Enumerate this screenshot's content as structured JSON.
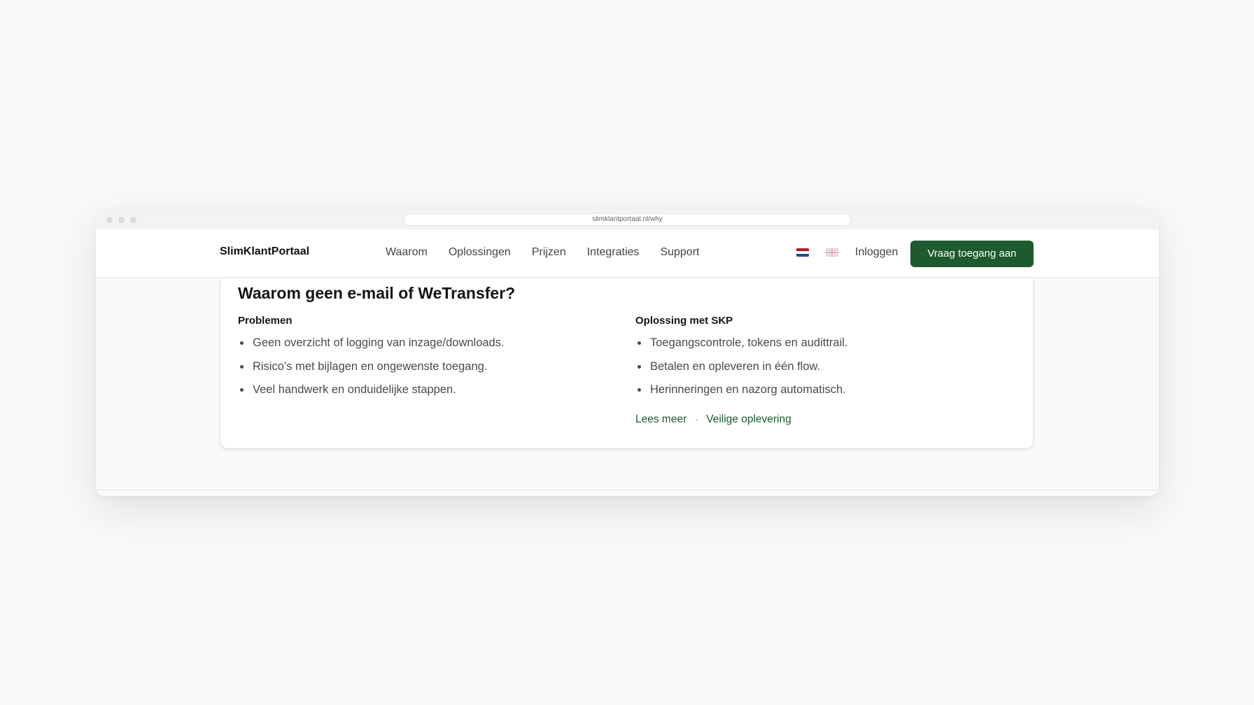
{
  "browser": {
    "url": "slimklantportaal.nl/why"
  },
  "navbar": {
    "brand": "SlimKlantPortaal",
    "links": [
      "Waarom",
      "Oplossingen",
      "Prijzen",
      "Integraties",
      "Support"
    ],
    "login": "Inloggen",
    "cta": "Vraag toegang aan",
    "flags": [
      "nl-flag-icon",
      "gb-flag-icon"
    ]
  },
  "card": {
    "title": "Waarom geen e-mail of WeTransfer?",
    "problems": {
      "heading": "Problemen",
      "items": [
        "Geen overzicht of logging van inzage/downloads.",
        "Risico’s met bijlagen en ongewenste toegang.",
        "Veel handwerk en onduidelijke stappen."
      ]
    },
    "solution": {
      "heading": "Oplossing met SKP",
      "items": [
        "Toegangscontrole, tokens en audittrail.",
        "Betalen en opleveren in één flow.",
        "Herinneringen en nazorg automatisch."
      ]
    },
    "links": {
      "read_more": "Lees meer",
      "separator": "·",
      "secure_delivery": "Veilige oplevering"
    }
  },
  "colors": {
    "accent": "#1d5b2f",
    "background": "#f9f9f9"
  }
}
